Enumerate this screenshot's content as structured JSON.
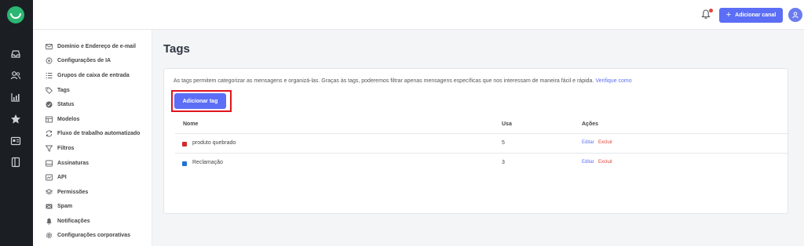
{
  "topbar": {
    "add_channel_label": "Adicionar canal",
    "plus_symbol": "+"
  },
  "sidebar": {
    "items": [
      {
        "label": "Domínio e Endereço de e-mail",
        "icon": "email-domain-icon"
      },
      {
        "label": "Configurações de IA",
        "icon": "ai-settings-icon"
      },
      {
        "label": "Grupos de caixa de entrada",
        "icon": "list-icon"
      },
      {
        "label": "Tags",
        "icon": "tag-icon"
      },
      {
        "label": "Status",
        "icon": "status-icon"
      },
      {
        "label": "Modelos",
        "icon": "templates-icon"
      },
      {
        "label": "Fluxo de trabalho automatizado",
        "icon": "workflow-icon"
      },
      {
        "label": "Filtros",
        "icon": "filter-icon"
      },
      {
        "label": "Assinaturas",
        "icon": "signature-icon"
      },
      {
        "label": "API",
        "icon": "api-icon"
      },
      {
        "label": "Permissões",
        "icon": "permissions-icon"
      },
      {
        "label": "Spam",
        "icon": "spam-icon"
      },
      {
        "label": "Notificações",
        "icon": "bell-icon"
      },
      {
        "label": "Configurações corporativas",
        "icon": "gear-icon"
      }
    ]
  },
  "main": {
    "title": "Tags",
    "description": "As tags permitem categorizar as mensagens e organizá-las. Graças às tags, poderemos filtrar apenas mensagens específicas que nos interessam de maneira fácil e rápida.",
    "learn_link": "Verifique como",
    "add_tag_label": "Adicionar tag",
    "table": {
      "headers": {
        "name": "Nome",
        "usage": "Usa",
        "actions": "Ações"
      },
      "rows": [
        {
          "name": "produto quebrado",
          "usage": "5",
          "color": "#d12b2b",
          "edit": "Editar",
          "delete": "Excluir"
        },
        {
          "name": "Reclamação",
          "usage": "3",
          "color": "#1f73d6",
          "edit": "Editar",
          "delete": "Excluir"
        }
      ]
    }
  },
  "colors": {
    "accent": "#5b6ef5",
    "rail": "#1b1f23",
    "logo": "#2bb673",
    "danger": "#e0453a",
    "highlight": "#e0141e"
  }
}
